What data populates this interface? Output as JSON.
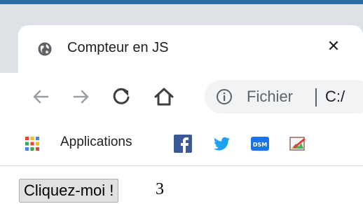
{
  "tab": {
    "title": "Compteur en JS",
    "close_glyph": "✕",
    "favicon": "globe-icon"
  },
  "toolbar": {
    "back_icon": "arrow-left-icon",
    "forward_icon": "arrow-right-icon",
    "reload_icon": "reload-icon",
    "home_icon": "home-icon"
  },
  "omnibox": {
    "info_icon": "info-icon",
    "scheme_label": "Fichier",
    "url_text": "C:/"
  },
  "bookmarks": {
    "apps_label": "Applications",
    "items": [
      {
        "icon": "facebook-icon",
        "color": "#3b5998"
      },
      {
        "icon": "twitter-icon",
        "color": "#1da1f2"
      },
      {
        "icon": "dsm-icon",
        "color": "#1a73e8"
      },
      {
        "icon": "edit-image-icon",
        "color": "#4caf50"
      }
    ]
  },
  "page": {
    "button_label": "Cliquez-moi !",
    "counter_value": "3"
  }
}
